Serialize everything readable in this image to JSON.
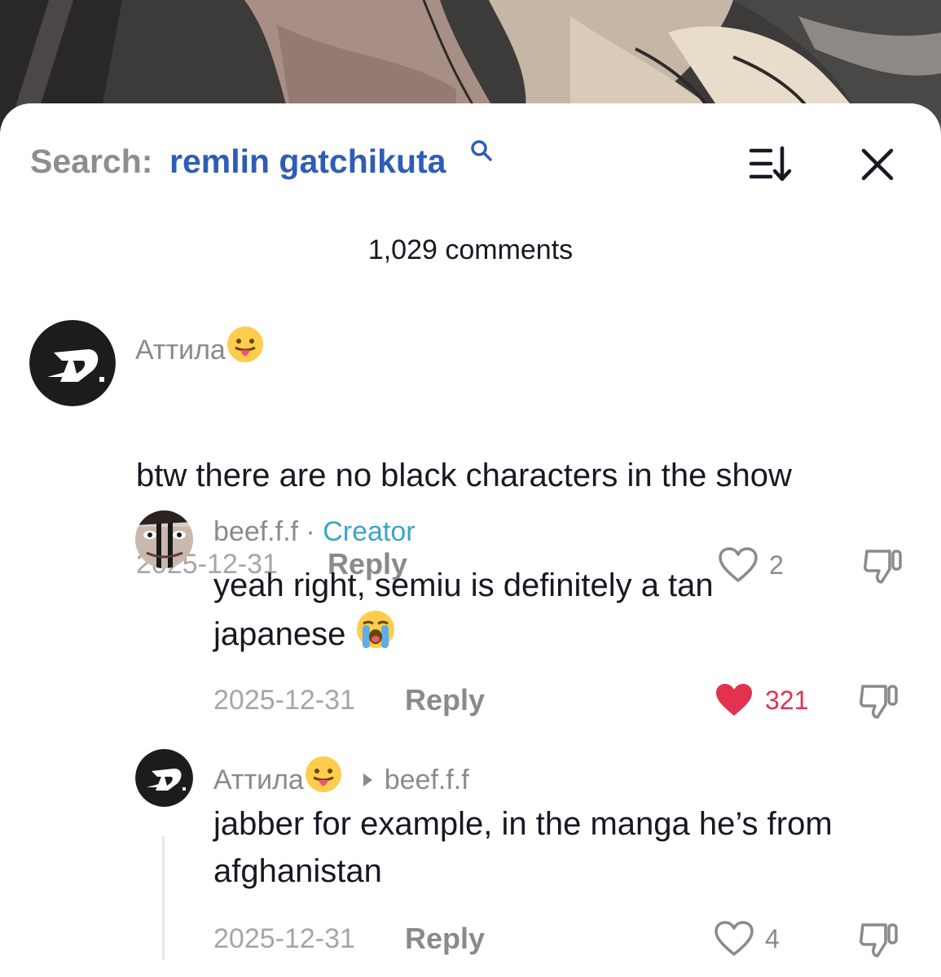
{
  "header": {
    "search_label": "Search:",
    "search_query": "remlin gatchikuta",
    "search_icon": "search-icon",
    "sort_icon": "sort-icon",
    "close_icon": "close-icon"
  },
  "comment_count": "1,029 comments",
  "comments": [
    {
      "username": "Аттила",
      "emoji": "😛",
      "text": "btw there are no black characters in the show",
      "date": "2025-12-31",
      "reply_label": "Reply",
      "likes": "2",
      "liked": false
    },
    {
      "username": "beef.f.f",
      "separator": "·",
      "badge": "Creator",
      "text": "yeah right, semiu is definitely a tan japanese",
      "emoji": "😭",
      "date": "2025-12-31",
      "reply_label": "Reply",
      "likes": "321",
      "liked": true
    },
    {
      "username": "Аттила",
      "emoji": "😛",
      "reply_to": "beef.f.f",
      "text": "jabber for example, in the manga he’s from afghanistan",
      "date": "2025-12-31",
      "reply_label": "Reply",
      "likes": "4",
      "liked": false
    }
  ],
  "colors": {
    "accent_blue": "#2f5db5",
    "creator_blue": "#3fa3c8",
    "like_red": "#e3324f",
    "text_dark": "#161823",
    "text_gray": "#8a8a8a"
  }
}
